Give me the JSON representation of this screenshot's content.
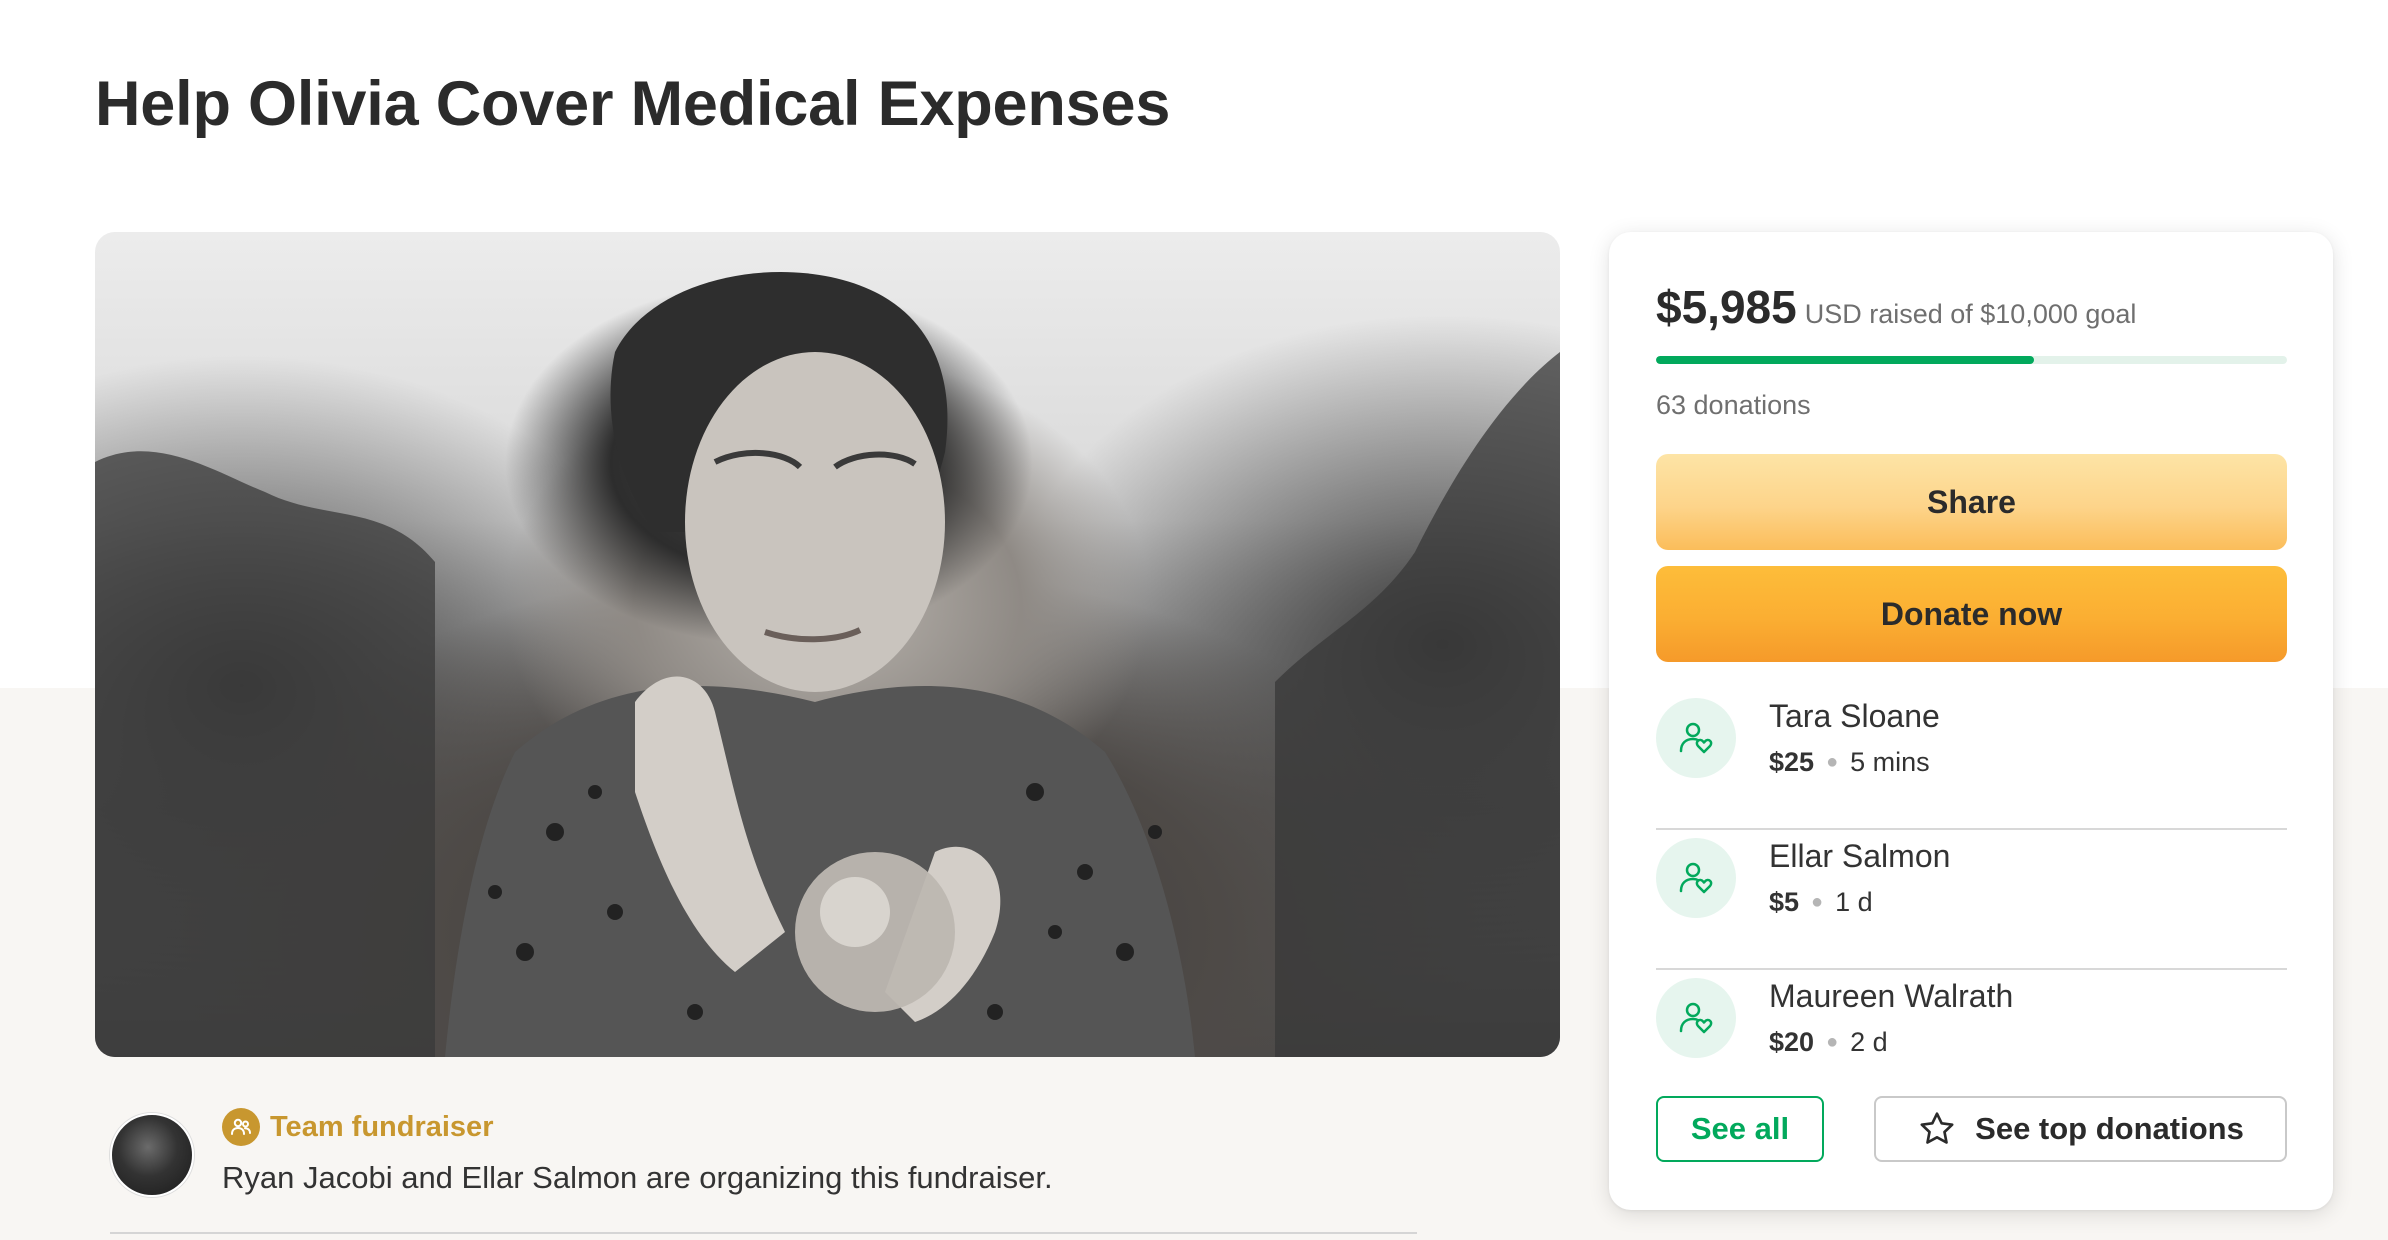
{
  "page": {
    "title": "Help Olivia Cover Medical Expenses"
  },
  "hero": {
    "alt": "Black and white photo of a woman holding a glass sphere"
  },
  "summary": {
    "amount": "$5,985",
    "raised_text": "USD raised of $10,000 goal",
    "progress_fraction": 0.5985,
    "donations_count": "63 donations",
    "share_label": "Share",
    "donate_label": "Donate now"
  },
  "donors": [
    {
      "name": "Tara Sloane",
      "amount": "$25",
      "time": "5 mins",
      "icon": "donor-heart-icon"
    },
    {
      "name": "Ellar Salmon",
      "amount": "$5",
      "time": "1 d",
      "icon": "donor-heart-icon"
    },
    {
      "name": "Maureen Walrath",
      "amount": "$20",
      "time": "2 d",
      "icon": "donor-heart-icon"
    }
  ],
  "actions": {
    "see_all_label": "See all",
    "see_top_label": "See top donations",
    "see_top_icon": "star-icon"
  },
  "organizer": {
    "team_label": "Team fundraiser",
    "team_icon": "team-icon",
    "text": "Ryan Jacobi and Ellar Salmon are organizing this fundraiser."
  },
  "colors": {
    "brand_green": "#02a95c",
    "share_yellow": "#fdd48a",
    "donate_orange": "#fbae32",
    "team_gold": "#c8972f"
  }
}
